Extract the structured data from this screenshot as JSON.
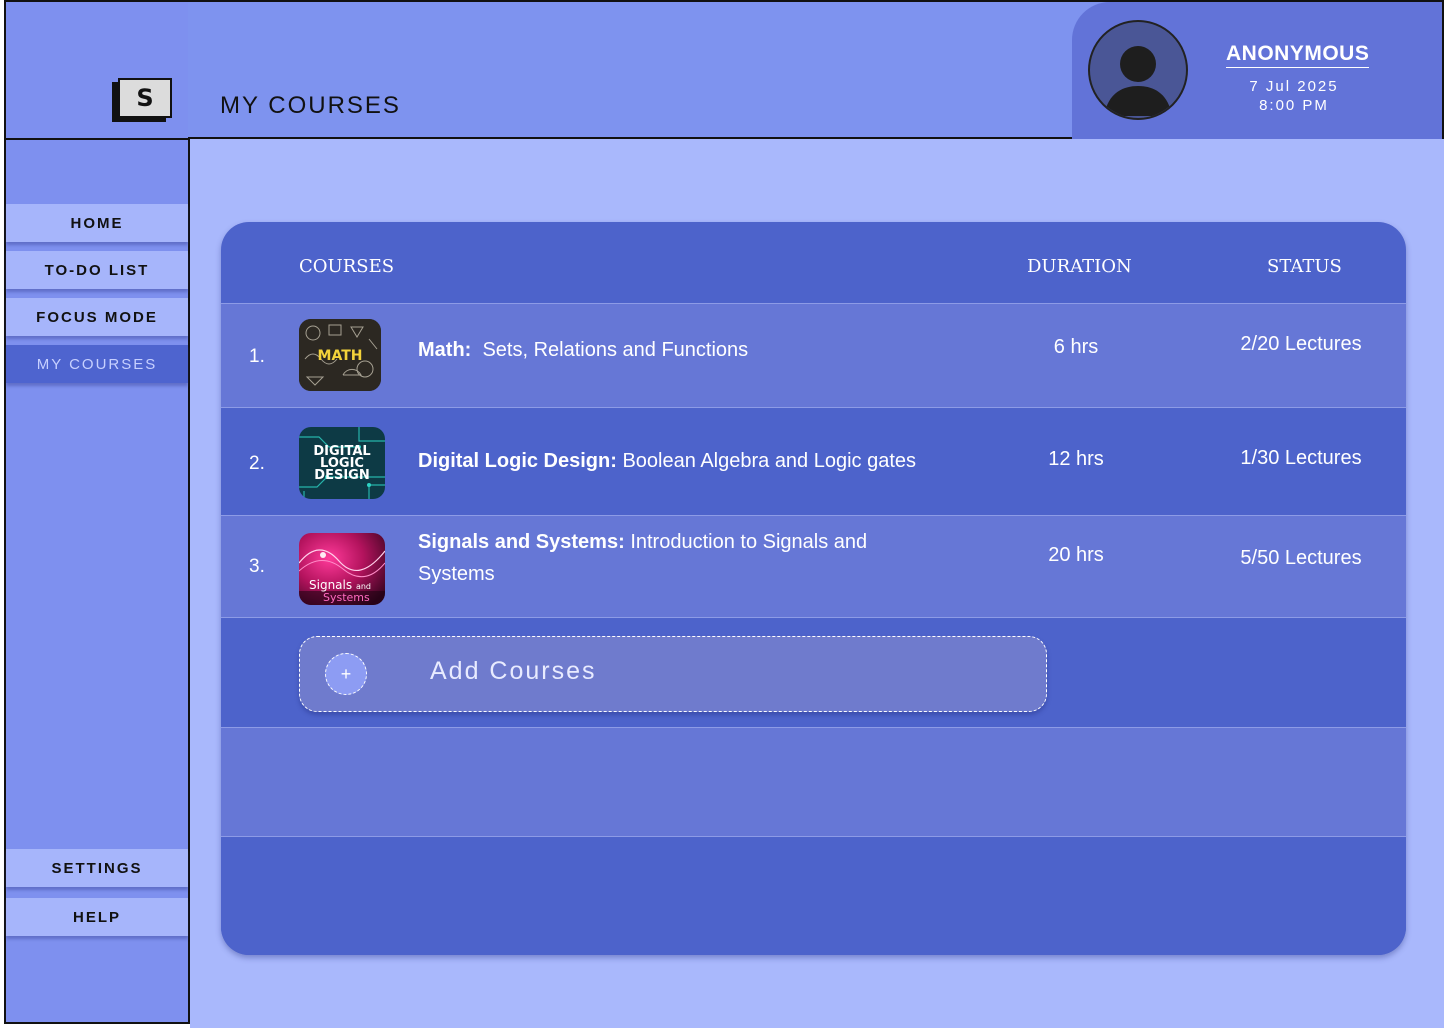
{
  "app": {
    "logo_letter": "S"
  },
  "header": {
    "title": "MY COURSES"
  },
  "user": {
    "name": "ANONYMOUS",
    "date": "7 Jul 2025",
    "time": "8:00 PM"
  },
  "nav": {
    "home": "HOME",
    "todo": "TO-DO LIST",
    "focus": "FOCUS MODE",
    "courses": "MY COURSES",
    "settings": "SETTINGS",
    "help": "HELP",
    "active": "courses"
  },
  "table": {
    "headers": {
      "courses": "COURSES",
      "duration": "DURATION",
      "status": "STATUS"
    },
    "rows": [
      {
        "num": "1.",
        "subject": "Math:",
        "topic": "Sets, Relations and Functions",
        "duration": "6 hrs",
        "status": "2/20 Lectures",
        "thumb_text": "MATH"
      },
      {
        "num": "2.",
        "subject": "Digital Logic Design:",
        "topic": "Boolean Algebra and Logic gates",
        "duration": "12 hrs",
        "status": "1/30 Lectures",
        "thumb_text": "DIGITAL LOGIC DESIGN"
      },
      {
        "num": "3.",
        "subject": "Signals and Systems:",
        "topic": "Introduction to Signals and Systems",
        "duration": "20 hrs",
        "status": "5/50 Lectures",
        "thumb_text": "Signals and Systems"
      }
    ]
  },
  "add": {
    "label": "Add Courses",
    "icon": "+"
  },
  "colors": {
    "sidebar": "#7e90ef",
    "header": "#7e93ef",
    "main": "#a9b8fc",
    "card": "#4d63cb",
    "row_light": "#6677d6",
    "nav_item": "#a6b5fb",
    "nav_active": "#4e64cf"
  }
}
